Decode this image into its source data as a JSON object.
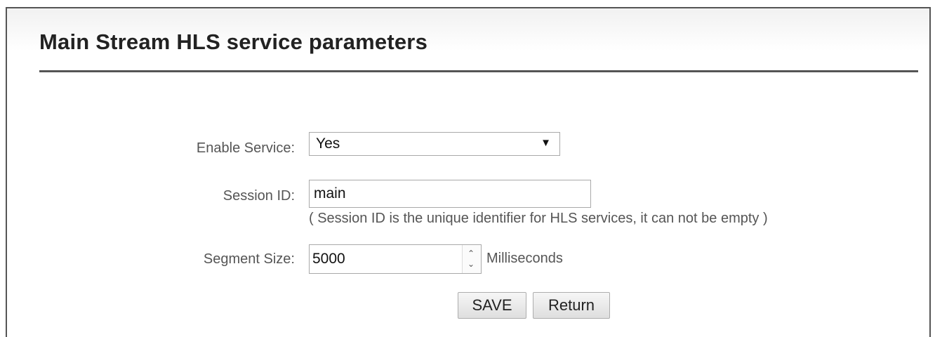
{
  "page": {
    "title": "Main Stream HLS service parameters"
  },
  "form": {
    "enable_service": {
      "label": "Enable Service:",
      "value": "Yes",
      "arrow": "▼"
    },
    "session_id": {
      "label": "Session ID:",
      "value": "main",
      "hint": "( Session ID is the unique identifier for HLS services, it can not be empty )"
    },
    "segment_size": {
      "label": "Segment Size:",
      "value": "5000",
      "unit": "Milliseconds",
      "spin_up": "⌃",
      "spin_down": "⌄"
    }
  },
  "buttons": {
    "save_label": "SAVE",
    "return_label": "Return"
  }
}
